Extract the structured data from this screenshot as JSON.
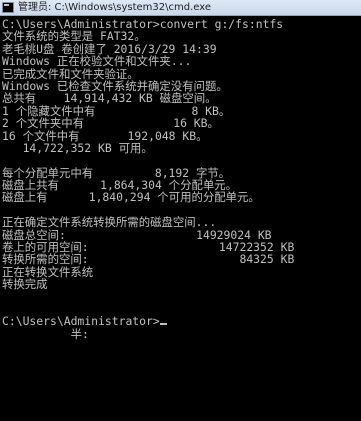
{
  "window": {
    "title": "管理员: C:\\Windows\\system32\\cmd.exe",
    "icon": "cmd-icon"
  },
  "console": {
    "lines": [
      "C:\\Users\\Administrator>convert g:/fs:ntfs",
      "文件系统的类型是 FAT32。",
      "老毛桃U盘 卷创建了 2016/3/29 14:39",
      "Windows 正在校验文件和文件夹...",
      "已完成文件和文件夹验证。",
      "Windows 已检查文件系统并确定没有问题。",
      "总共有    14,914,432 KB 磁盘空间。",
      "1 个隐藏文件中有              8 KB。",
      "2 个文件夹中有             16 KB。",
      "16 个文件中有       192,048 KB。",
      "   14,722,352 KB 可用。",
      "",
      "每个分配单元中有         8,192 字节。",
      "磁盘上共有      1,864,304 个分配单元。",
      "磁盘上有      1,840,294 个可用的分配单元。",
      "",
      "正在确定文件系统转换所需的磁盘空间...",
      "磁盘总空间:                   14929024 KB",
      "卷上的可用空间:                   14722352 KB",
      "转换所需的空间:                      84325 KB",
      "正在转换文件系统",
      "转换完成",
      "",
      ""
    ],
    "prompt": "C:\\Users\\Administrator>",
    "ime_status": "          半:"
  }
}
